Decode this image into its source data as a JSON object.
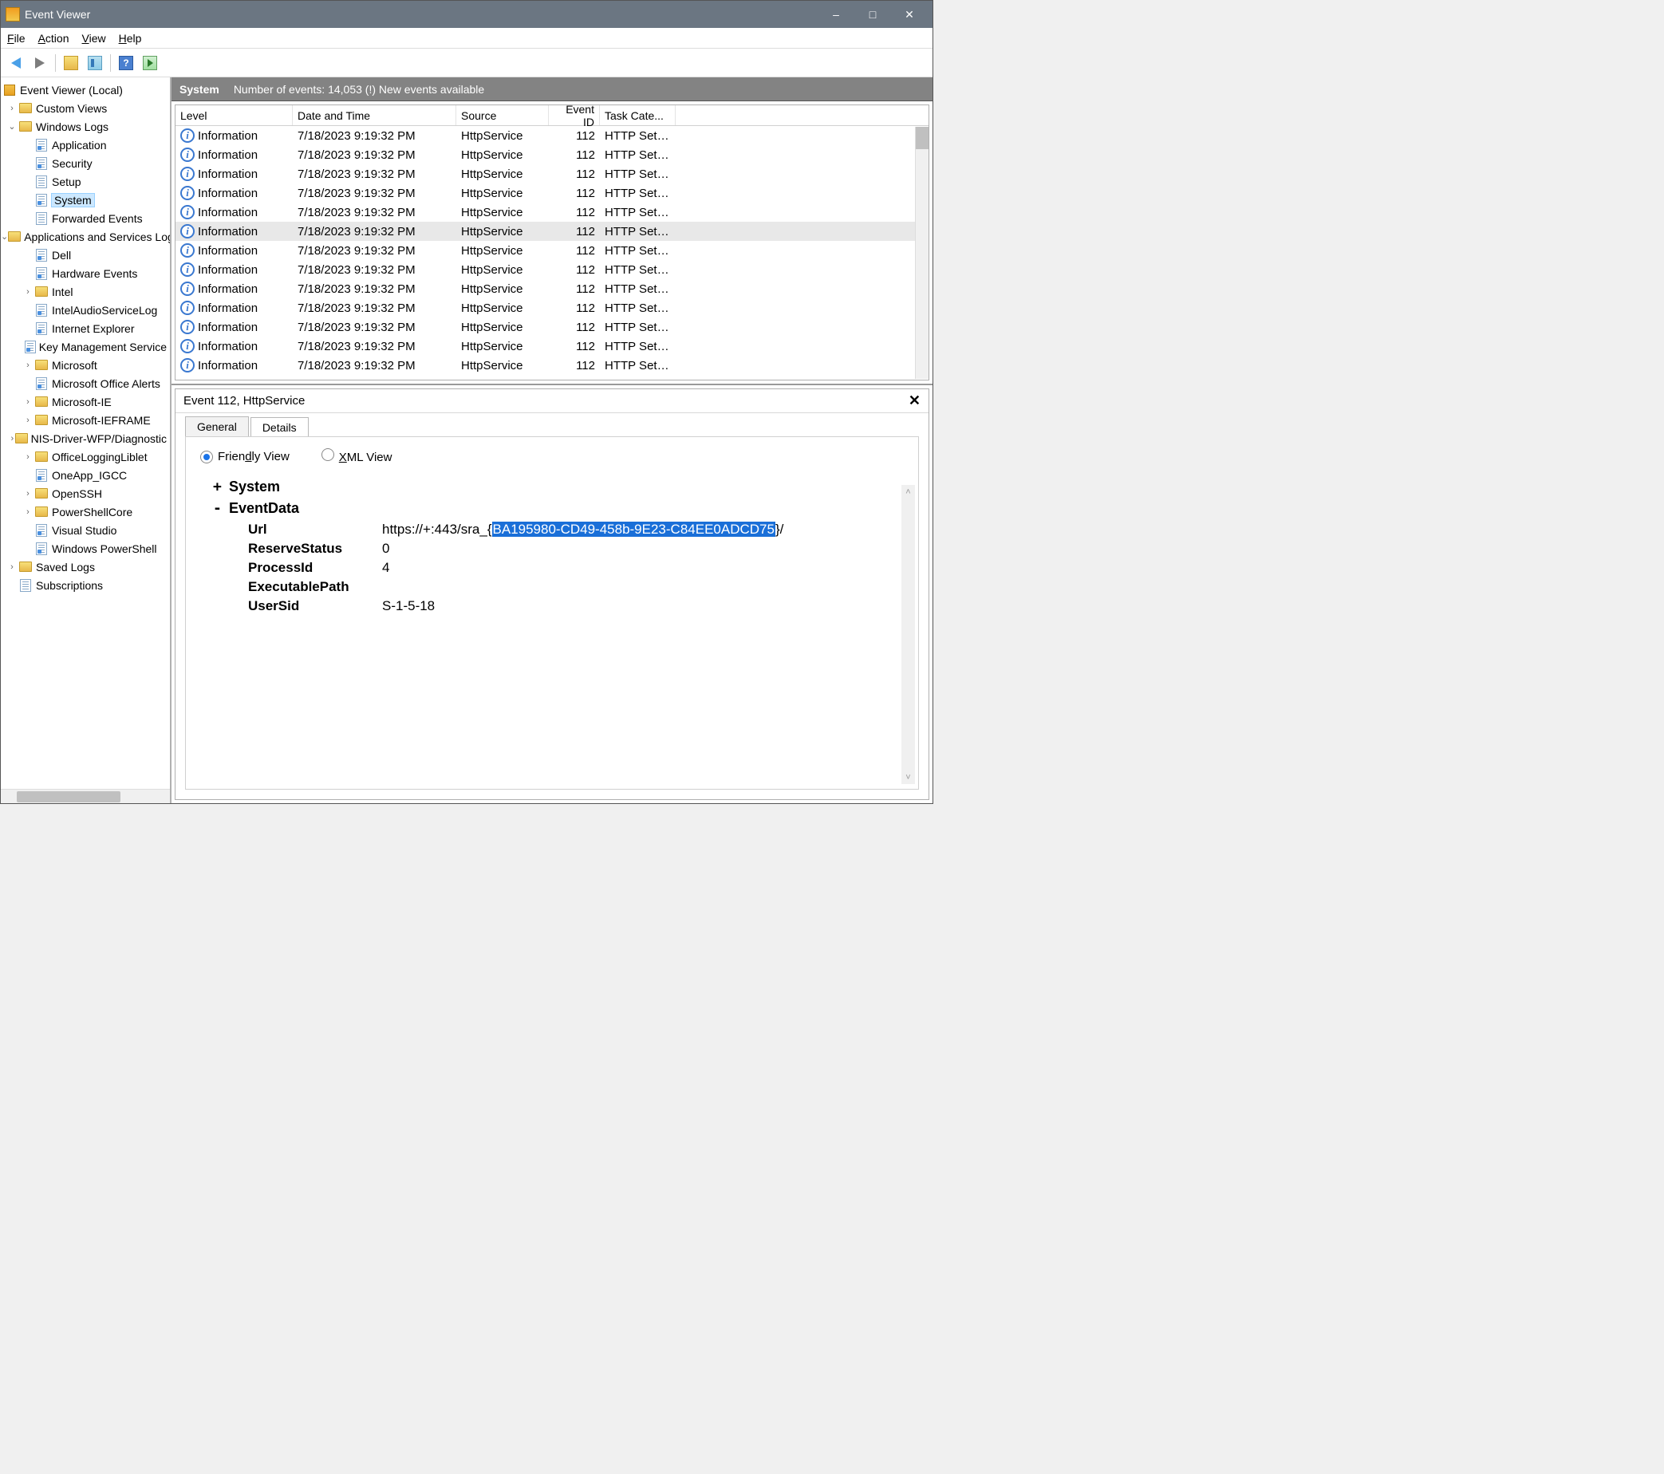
{
  "title": "Event Viewer",
  "menu": {
    "file": "File",
    "action": "Action",
    "view": "View",
    "help": "Help"
  },
  "tree": {
    "root": "Event Viewer (Local)",
    "custom": "Custom Views",
    "winlogs": "Windows Logs",
    "application": "Application",
    "security": "Security",
    "setup": "Setup",
    "system": "System",
    "forwarded": "Forwarded Events",
    "appsservices": "Applications and Services Logs",
    "dell": "Dell",
    "hw": "Hardware Events",
    "intel": "Intel",
    "intelaudio": "IntelAudioServiceLog",
    "ie": "Internet Explorer",
    "kms": "Key Management Service",
    "ms": "Microsoft",
    "msoffice": "Microsoft Office Alerts",
    "msie": "Microsoft-IE",
    "msieframe": "Microsoft-IEFRAME",
    "nis": "NIS-Driver-WFP/Diagnostic",
    "officelog": "OfficeLoggingLiblet",
    "oneapp": "OneApp_IGCC",
    "openssh": "OpenSSH",
    "pscore": "PowerShellCore",
    "vs": "Visual Studio",
    "winps": "Windows PowerShell",
    "savedlogs": "Saved Logs",
    "subs": "Subscriptions"
  },
  "rightHeader": {
    "title": "System",
    "subtitle": "Number of events: 14,053 (!) New events available"
  },
  "columns": {
    "level": "Level",
    "date": "Date and Time",
    "source": "Source",
    "eid": "Event ID",
    "task": "Task Cate..."
  },
  "rows": [
    {
      "level": "Information",
      "date": "7/18/2023 9:19:32 PM",
      "source": "HttpService",
      "eid": "112",
      "task": "HTTP Setu..."
    },
    {
      "level": "Information",
      "date": "7/18/2023 9:19:32 PM",
      "source": "HttpService",
      "eid": "112",
      "task": "HTTP Setu..."
    },
    {
      "level": "Information",
      "date": "7/18/2023 9:19:32 PM",
      "source": "HttpService",
      "eid": "112",
      "task": "HTTP Setu..."
    },
    {
      "level": "Information",
      "date": "7/18/2023 9:19:32 PM",
      "source": "HttpService",
      "eid": "112",
      "task": "HTTP Setu..."
    },
    {
      "level": "Information",
      "date": "7/18/2023 9:19:32 PM",
      "source": "HttpService",
      "eid": "112",
      "task": "HTTP Setu..."
    },
    {
      "level": "Information",
      "date": "7/18/2023 9:19:32 PM",
      "source": "HttpService",
      "eid": "112",
      "task": "HTTP Setu...",
      "selected": true
    },
    {
      "level": "Information",
      "date": "7/18/2023 9:19:32 PM",
      "source": "HttpService",
      "eid": "112",
      "task": "HTTP Setu..."
    },
    {
      "level": "Information",
      "date": "7/18/2023 9:19:32 PM",
      "source": "HttpService",
      "eid": "112",
      "task": "HTTP Setu..."
    },
    {
      "level": "Information",
      "date": "7/18/2023 9:19:32 PM",
      "source": "HttpService",
      "eid": "112",
      "task": "HTTP Setu..."
    },
    {
      "level": "Information",
      "date": "7/18/2023 9:19:32 PM",
      "source": "HttpService",
      "eid": "112",
      "task": "HTTP Setu..."
    },
    {
      "level": "Information",
      "date": "7/18/2023 9:19:32 PM",
      "source": "HttpService",
      "eid": "112",
      "task": "HTTP Setu..."
    },
    {
      "level": "Information",
      "date": "7/18/2023 9:19:32 PM",
      "source": "HttpService",
      "eid": "112",
      "task": "HTTP Setu..."
    },
    {
      "level": "Information",
      "date": "7/18/2023 9:19:32 PM",
      "source": "HttpService",
      "eid": "112",
      "task": "HTTP Setu..."
    }
  ],
  "detail": {
    "title": "Event 112, HttpService",
    "tabs": {
      "general": "General",
      "details": "Details"
    },
    "radios": {
      "friendly": "Friendly View",
      "xml": "XML View"
    },
    "system": "System",
    "eventdata": "EventData",
    "fields": {
      "url_label": "Url",
      "url_pre": "https://+:443/sra_{",
      "url_sel": "BA195980-CD49-458b-9E23-C84EE0ADCD75",
      "url_post": "}/",
      "reserve_label": "ReserveStatus",
      "reserve_val": "0",
      "pid_label": "ProcessId",
      "pid_val": "4",
      "exe_label": "ExecutablePath",
      "exe_val": "",
      "sid_label": "UserSid",
      "sid_val": "S-1-5-18"
    }
  }
}
